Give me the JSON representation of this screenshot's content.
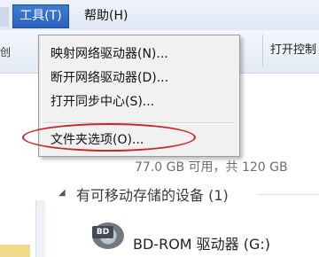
{
  "menubar": {
    "tools_label": "工具(T)",
    "help_label": "帮助(H)"
  },
  "toolbar": {
    "left_label": "创",
    "right_label": "打开控制"
  },
  "dropdown": {
    "items": [
      "映射网络驱动器(N)...",
      "断开网络驱动器(D)...",
      "打开同步中心(S)...",
      "文件夹选项(O)..."
    ]
  },
  "content": {
    "disk_info": "77.0 GB 可用，共 120 GB",
    "section_title": "有可移动存储的设备 (1)",
    "bd_badge": "BD",
    "bd_drive_label": "BD-ROM 驱动器 (G:)"
  },
  "colors": {
    "menu_highlight": "#2a63bd",
    "annotation_red": "#c62828"
  }
}
